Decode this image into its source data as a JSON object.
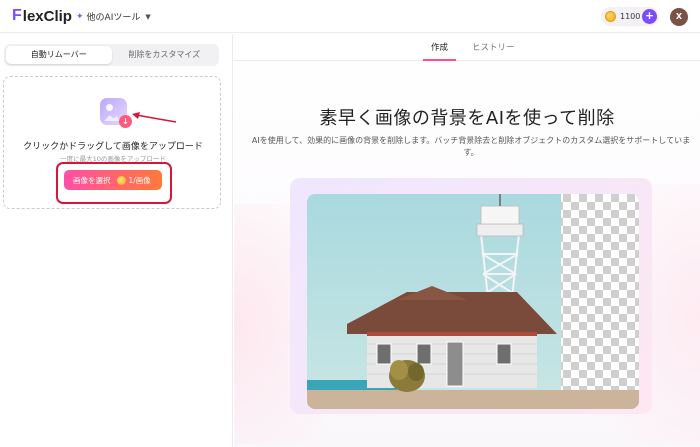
{
  "header": {
    "logo_mark": "F",
    "logo_text": "lexClip",
    "ai_tools_label": "他のAIツール",
    "credits": "1100",
    "avatar_initial": "X"
  },
  "left": {
    "tabs": [
      {
        "label": "自動リムーバー"
      },
      {
        "label": "削除をカスタマイズ"
      }
    ],
    "upload_title": "クリックかドラッグして画像をアップロード",
    "upload_subtitle": "一度に最大10の画像をアップロード",
    "select_button_label": "画像を選択",
    "select_button_cost": "1/画像"
  },
  "main": {
    "tabs": [
      {
        "label": "作成"
      },
      {
        "label": "ヒストリー"
      }
    ],
    "headline": "素早く画像の背景をAIを使って削除",
    "description": "AIを使用して、効果的に画像の背景を削除します。バッチ背景除去と削除オブジェクトのカスタム選択をサポートしています。"
  },
  "colors": {
    "accent": "#7b4bff",
    "brand_pink": "#ff4fa6",
    "brand_orange": "#ff7a3a",
    "highlight_red": "#d4173a"
  }
}
